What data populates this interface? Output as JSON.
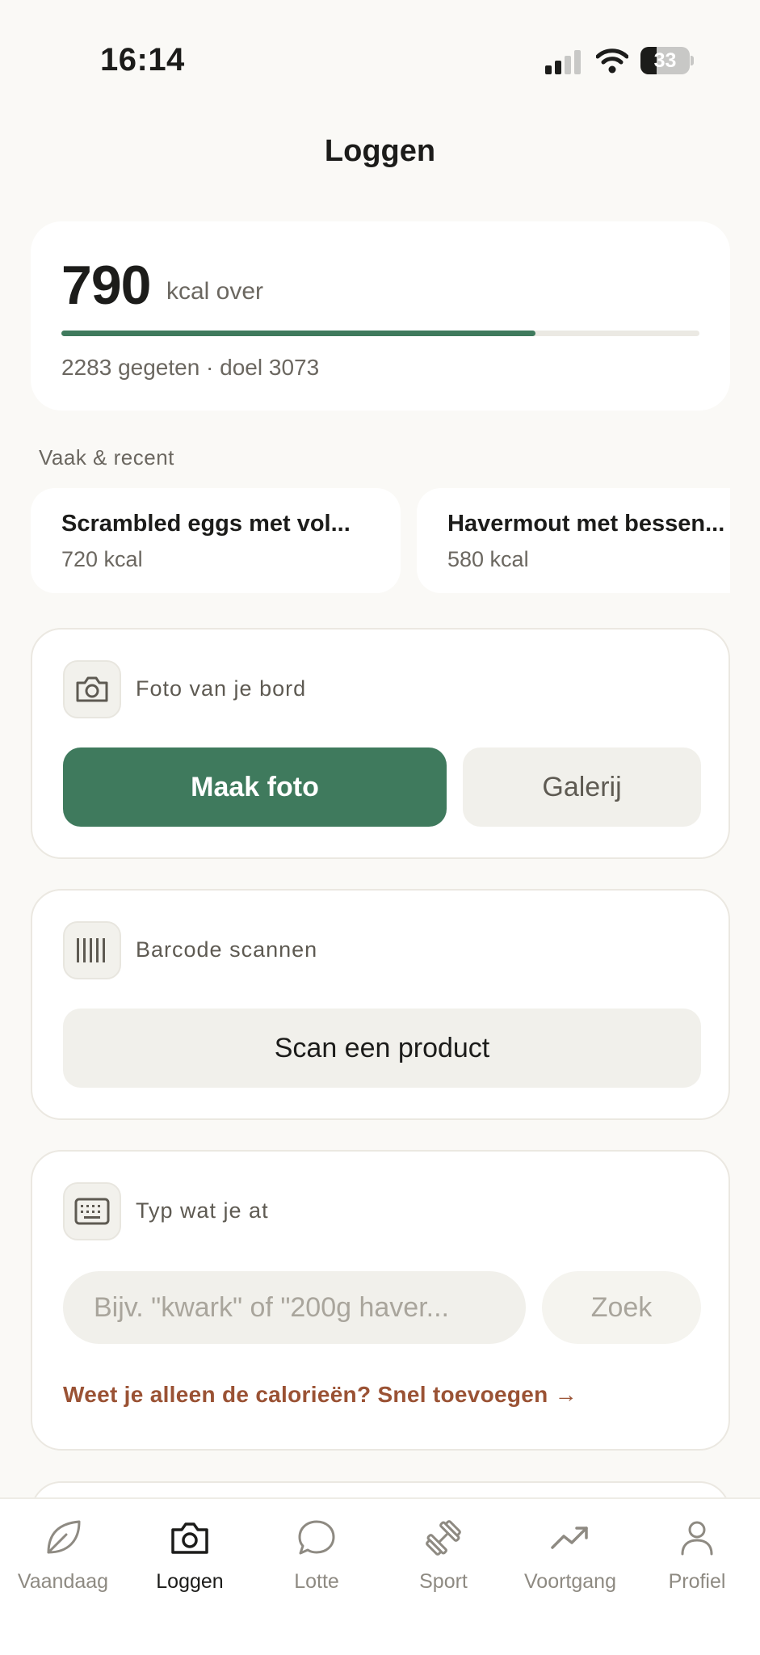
{
  "status_bar": {
    "time": "16:14",
    "battery_level": "33",
    "battery_fraction": 0.33
  },
  "header": {
    "title": "Loggen"
  },
  "summary": {
    "value": "790",
    "unit": "kcal over",
    "eaten": 2283,
    "goal": 3073,
    "progress_fraction": 0.743,
    "subtitle": "2283 gegeten · doel 3073"
  },
  "recent": {
    "label": "Vaak & recent",
    "items": [
      {
        "name": "Scrambled eggs met vol...",
        "kcal": "720 kcal"
      },
      {
        "name": "Havermout met bessen...",
        "kcal": "580 kcal"
      }
    ]
  },
  "photo": {
    "title": "Foto van je bord",
    "primary": "Maak foto",
    "secondary": "Galerij",
    "icon": "camera-icon"
  },
  "barcode": {
    "title": "Barcode scannen",
    "button": "Scan een product",
    "icon": "barcode-icon"
  },
  "type": {
    "title": "Typ wat je at",
    "placeholder": "Bijv. \"kwark\" of \"200g haver...",
    "search": "Zoek",
    "quick_link": "Weet je alleen de calorieën? Snel toevoegen →",
    "icon": "keyboard-icon"
  },
  "colors": {
    "accent": "#3f7a5d",
    "link": "#9a5234",
    "background": "#faf9f6"
  },
  "nav": {
    "active": "Loggen",
    "items": [
      {
        "label": "Vaandaag",
        "icon": "leaf-icon"
      },
      {
        "label": "Loggen",
        "icon": "camera-icon"
      },
      {
        "label": "Lotte",
        "icon": "chat-bubble-icon"
      },
      {
        "label": "Sport",
        "icon": "dumbbell-icon"
      },
      {
        "label": "Voortgang",
        "icon": "trend-up-icon"
      },
      {
        "label": "Profiel",
        "icon": "person-icon"
      }
    ]
  }
}
